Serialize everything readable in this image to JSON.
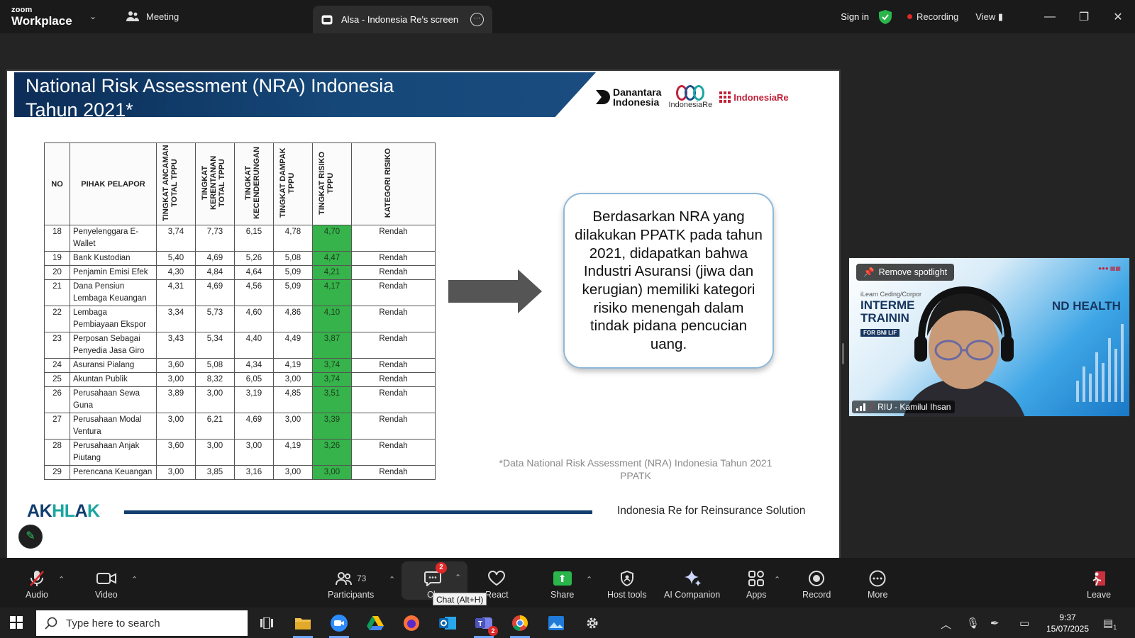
{
  "titlebar": {
    "brand_top": "zoom",
    "brand_bottom": "Workplace",
    "meeting_label": "Meeting",
    "tab_label": "Alsa - Indonesia Re's screen",
    "sign_in": "Sign in",
    "recording": "Recording",
    "view": "View"
  },
  "slide": {
    "title": "National Risk Assessment (NRA) Indonesia\nTahun 2021*",
    "logos": {
      "danantara": "Danantara\nIndonesia",
      "indonesiare": "IndonesiaRe",
      "institute": "IndonesiaRe"
    },
    "table": {
      "headers": [
        "NO",
        "PIHAK PELAPOR",
        "TINGKAT ANCAMAN TOTAL TPPU",
        "TINGKAT KERENTANAN TOTAL TPPU",
        "TINGKAT KECENDERUNGAN",
        "TINGKAT DAMPAK TPPU",
        "TINGKAT RISIKO TPPU",
        "KATEGORI RISIKO"
      ],
      "rows": [
        [
          "18",
          "Penyelenggara E-Wallet",
          "3,74",
          "7,73",
          "6,15",
          "4,78",
          "4,70",
          "Rendah"
        ],
        [
          "19",
          "Bank Kustodian",
          "5,40",
          "4,69",
          "5,26",
          "5,08",
          "4,47",
          "Rendah"
        ],
        [
          "20",
          "Penjamin Emisi Efek",
          "4,30",
          "4,84",
          "4,64",
          "5,09",
          "4,21",
          "Rendah"
        ],
        [
          "21",
          "Dana Pensiun Lembaga Keuangan",
          "4,31",
          "4,69",
          "4,56",
          "5,09",
          "4,17",
          "Rendah"
        ],
        [
          "22",
          "Lembaga Pembiayaan Ekspor",
          "3,34",
          "5,73",
          "4,60",
          "4,86",
          "4,10",
          "Rendah"
        ],
        [
          "23",
          "Perposan Sebagai Penyedia Jasa Giro",
          "3,43",
          "5,34",
          "4,40",
          "4,49",
          "3,87",
          "Rendah"
        ],
        [
          "24",
          "Asuransi Pialang",
          "3,60",
          "5,08",
          "4,34",
          "4,19",
          "3,74",
          "Rendah"
        ],
        [
          "25",
          "Akuntan Publik",
          "3,00",
          "8,32",
          "6,05",
          "3,00",
          "3,74",
          "Rendah"
        ],
        [
          "26",
          "Perusahaan Sewa Guna",
          "3,89",
          "3,00",
          "3,19",
          "4,85",
          "3,51",
          "Rendah"
        ],
        [
          "27",
          "Perusahaan Modal Ventura",
          "3,00",
          "6,21",
          "4,69",
          "3,00",
          "3,39",
          "Rendah"
        ],
        [
          "28",
          "Perusahaan Anjak Piutang",
          "3,60",
          "3,00",
          "3,00",
          "4,19",
          "3,26",
          "Rendah"
        ],
        [
          "29",
          "Perencana Keuangan",
          "3,00",
          "3,85",
          "3,16",
          "3,00",
          "3,00",
          "Rendah"
        ]
      ]
    },
    "callout": "Berdasarkan NRA yang dilakukan PPATK pada tahun 2021, didapatkan bahwa Industri Asuransi (jiwa dan kerugian) memiliki kategori risiko menengah dalam tindak pidana pencucian uang.",
    "source_note": "*Data National Risk Assessment (NRA) Indonesia Tahun 2021\nPPATK",
    "akhlak": [
      "A",
      "K",
      "H",
      "L",
      "A",
      "K"
    ],
    "footer": "Indonesia Re for Reinsurance Solution"
  },
  "video": {
    "remove_spotlight": "Remove spotlight",
    "poster_line1": "iLearn Ceding/Corpor",
    "poster_line2": "INTERME\nTRAININ",
    "poster_line3": "ND HEALTH",
    "poster_line4": "FOR BNI LIF",
    "participant_name": "RIU - Kamilul Ihsan"
  },
  "toolbar": {
    "audio": "Audio",
    "video": "Video",
    "participants": "Participants",
    "participants_count": "73",
    "chat": "Ch",
    "chat_badge": "2",
    "chat_tooltip": "Chat (Alt+H)",
    "react": "React",
    "share": "Share",
    "host_tools": "Host tools",
    "ai_companion": "AI Companion",
    "apps": "Apps",
    "record": "Record",
    "more": "More",
    "leave": "Leave"
  },
  "taskbar": {
    "search_placeholder": "Type here to search",
    "teams_badge": "2",
    "time": "9:37",
    "date": "15/07/2025",
    "notif_count": "1"
  },
  "colors": {
    "risk_green": "#36b34a",
    "header_navy": "#0c2d57",
    "rec_red": "#e02828",
    "share_green": "#2bb64b"
  }
}
